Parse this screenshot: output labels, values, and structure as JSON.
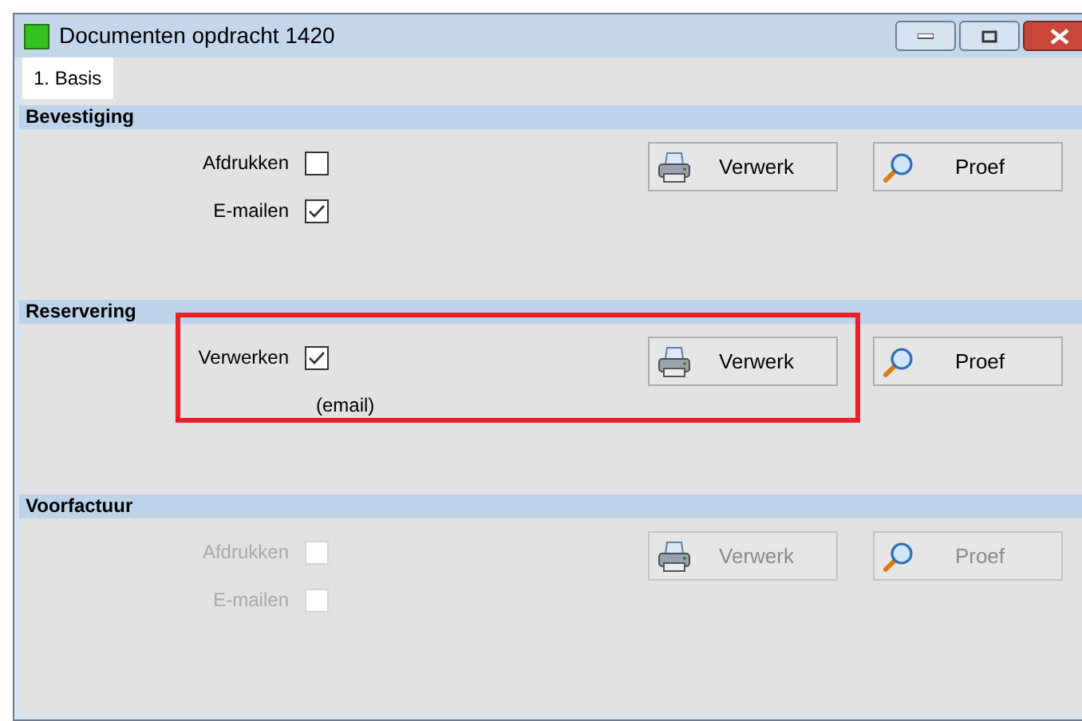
{
  "window": {
    "title": "Documenten opdracht 1420"
  },
  "tabs": [
    {
      "label": "1. Basis",
      "selected": true
    }
  ],
  "sections": [
    {
      "title": "Bevestiging",
      "highlighted": false,
      "rows": [
        {
          "kind": "checkbox",
          "label": "Afdrukken",
          "checked": false,
          "disabled": false
        },
        {
          "kind": "checkbox",
          "label": "E-mailen",
          "checked": true,
          "disabled": false
        }
      ],
      "buttons": [
        {
          "kind": "print",
          "label": "Verwerk",
          "disabled": false
        },
        {
          "kind": "preview",
          "label": "Proef",
          "disabled": false
        }
      ]
    },
    {
      "title": "Reservering",
      "highlighted": true,
      "rows": [
        {
          "kind": "checkbox",
          "label": "Verwerken",
          "checked": true,
          "disabled": false
        },
        {
          "kind": "note",
          "text": "(email)"
        }
      ],
      "buttons": [
        {
          "kind": "print",
          "label": "Verwerk",
          "disabled": false
        },
        {
          "kind": "preview",
          "label": "Proef",
          "disabled": false
        }
      ]
    },
    {
      "title": "Voorfactuur",
      "highlighted": false,
      "rows": [
        {
          "kind": "checkbox",
          "label": "Afdrukken",
          "checked": false,
          "disabled": true
        },
        {
          "kind": "checkbox",
          "label": "E-mailen",
          "checked": false,
          "disabled": true
        }
      ],
      "buttons": [
        {
          "kind": "print",
          "label": "Verwerk",
          "disabled": true
        },
        {
          "kind": "preview",
          "label": "Proef",
          "disabled": true
        }
      ]
    }
  ]
}
